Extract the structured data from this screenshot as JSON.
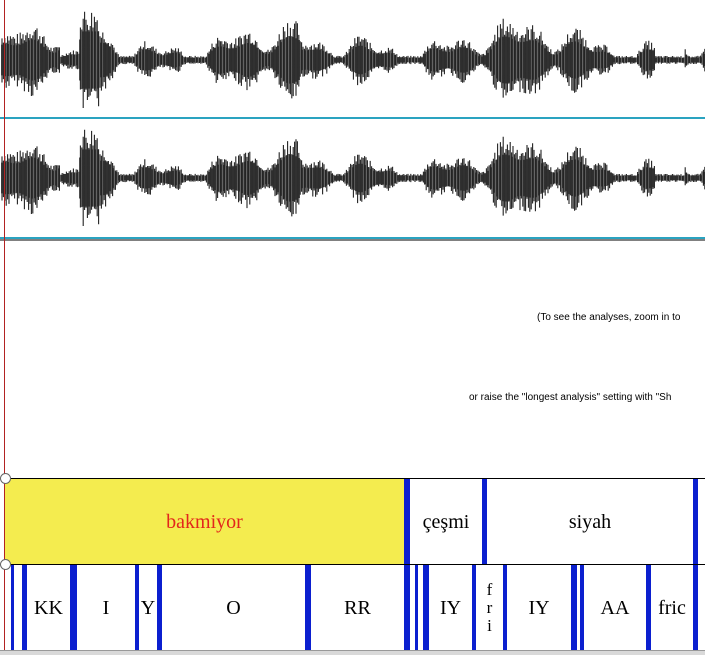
{
  "colors": {
    "waveform": "#222222",
    "channel_line": "#2aa3c0",
    "boundary": "#0b1fcf",
    "selection_bg": "#f4ec4f",
    "selection_text": "#e3261b",
    "cursor": "#b22222"
  },
  "analysis_message": {
    "line1": "(To see the analyses, zoom in to",
    "line2": "or raise the \"longest analysis\" setting with \"Sh"
  },
  "word_tier": {
    "intervals": [
      {
        "label": "bakmiyor",
        "selected": true
      },
      {
        "label": "çeşmi",
        "selected": false
      },
      {
        "label": "siyah",
        "selected": false
      }
    ]
  },
  "phone_tier": {
    "intervals": [
      {
        "label": "KK"
      },
      {
        "label": "I"
      },
      {
        "label": "Y"
      },
      {
        "label": "O"
      },
      {
        "label": "RR"
      },
      {
        "label": "IY"
      },
      {
        "label": "fri"
      },
      {
        "label": "IY"
      },
      {
        "label": "AA"
      },
      {
        "label": "fric"
      }
    ]
  }
}
